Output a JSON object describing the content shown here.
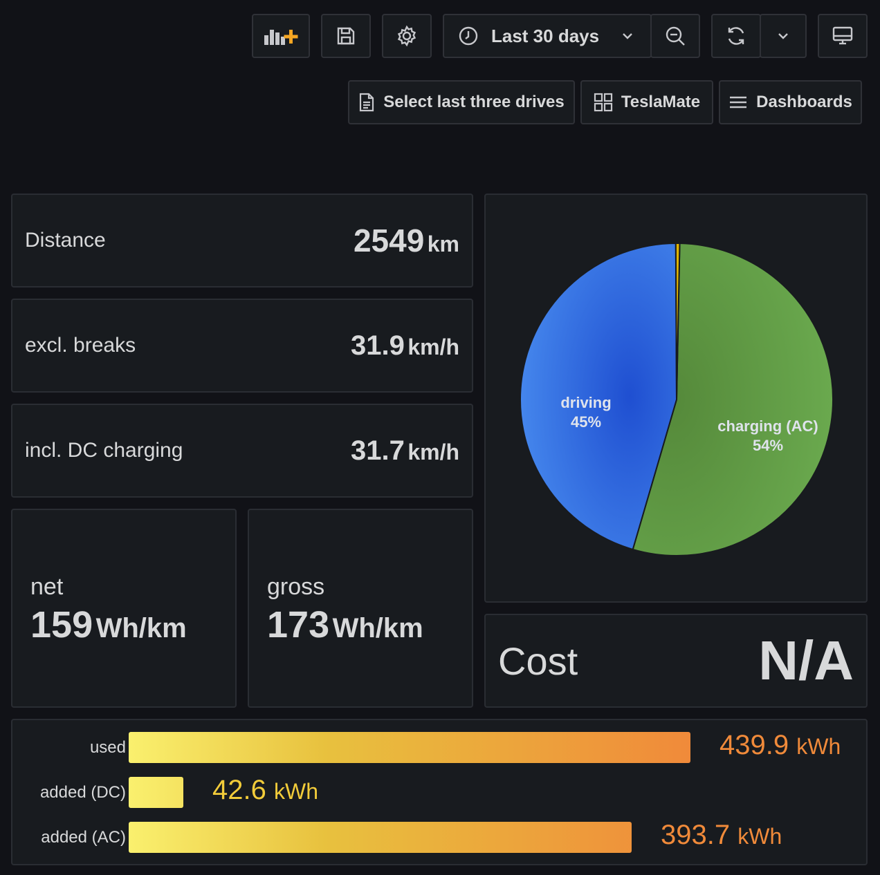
{
  "toolbar": {
    "time_range": "Last 30 days",
    "select_last_drives": "Select last three drives",
    "teslamate": "TeslaMate",
    "dashboards": "Dashboards"
  },
  "stats": {
    "distance": {
      "label": "Distance",
      "value": "2549",
      "unit": "km"
    },
    "excl_breaks": {
      "label": "excl. breaks",
      "value": "31.9",
      "unit": "km/h"
    },
    "incl_dc": {
      "label": "incl. DC charging",
      "value": "31.7",
      "unit": "km/h"
    },
    "net": {
      "label": "net",
      "value": "159",
      "unit": "Wh/km"
    },
    "gross": {
      "label": "gross",
      "value": "173",
      "unit": "Wh/km"
    },
    "cost": {
      "label": "Cost",
      "value": "N/A"
    }
  },
  "pie": {
    "slices": [
      {
        "name": "driving",
        "pct_label": "45%",
        "value": 45.4,
        "color": "#3b7be6"
      },
      {
        "name": "charging (AC)",
        "pct_label": "54%",
        "value": 54.2,
        "color": "#5f9d45"
      },
      {
        "name": "",
        "pct_label": "",
        "value": 0.4,
        "color": "#e0b400"
      }
    ]
  },
  "energy": {
    "max": 439.9,
    "rows": [
      {
        "label": "used",
        "value": "439.9",
        "num": 439.9,
        "unit": "kWh",
        "color": "#f08a3a"
      },
      {
        "label": "added (DC)",
        "value": "42.6",
        "num": 42.6,
        "unit": "kWh",
        "color": "#f2cc3a"
      },
      {
        "label": "added (AC)",
        "value": "393.7",
        "num": 393.7,
        "unit": "kWh",
        "color": "#f08a3a"
      }
    ]
  }
}
